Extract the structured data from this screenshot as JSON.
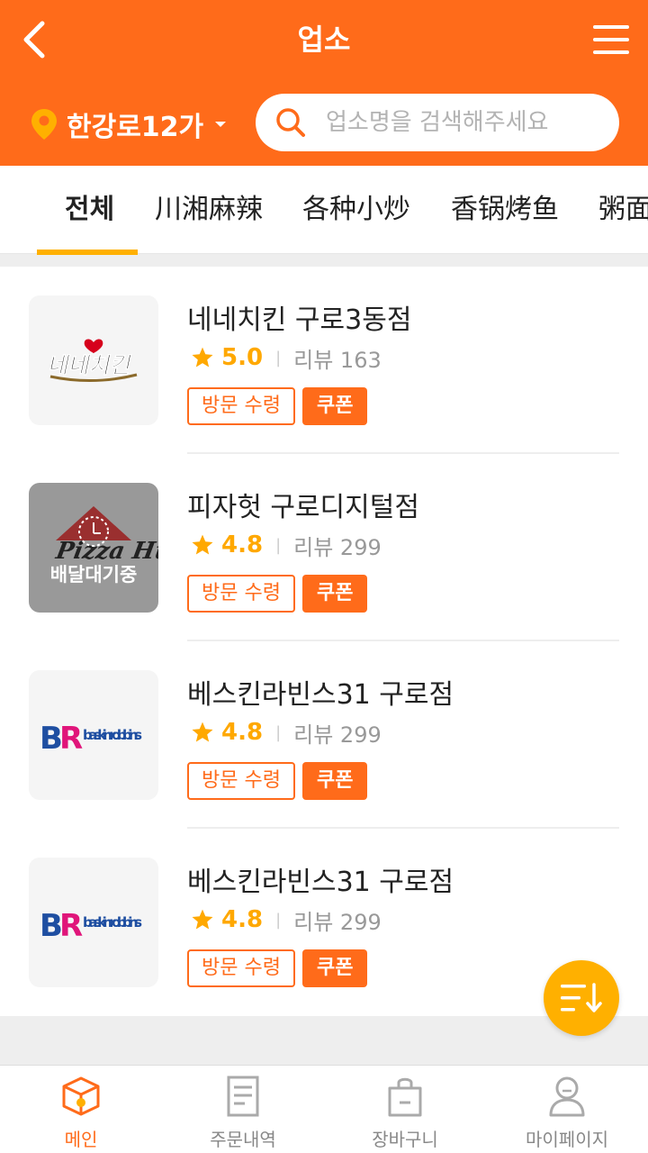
{
  "header": {
    "title": "업소",
    "location": "한강로12가",
    "search_placeholder": "업소명을 검색해주세요"
  },
  "tabs": [
    {
      "label": "전체",
      "active": true
    },
    {
      "label": "川湘麻辣",
      "active": false
    },
    {
      "label": "各种小炒",
      "active": false
    },
    {
      "label": "香锅烤鱼",
      "active": false
    },
    {
      "label": "粥面",
      "active": false
    }
  ],
  "stores": [
    {
      "name": "네네치킨 구로3동점",
      "score": "5.0",
      "reviews": "리뷰 163",
      "tag_visit": "방문 수령",
      "tag_coupon": "쿠폰",
      "logo": "nene-chicken-logo",
      "logo_text": "네네치킨",
      "overlay": null
    },
    {
      "name": "피자헛 구로디지털점",
      "score": "4.8",
      "reviews": "리뷰 299",
      "tag_visit": "방문 수령",
      "tag_coupon": "쿠폰",
      "logo": "pizza-hut-logo",
      "logo_text": "Pizza Hut",
      "overlay": "배달대기중"
    },
    {
      "name": "베스킨라빈스31 구로점",
      "score": "4.8",
      "reviews": "리뷰 299",
      "tag_visit": "방문 수령",
      "tag_coupon": "쿠폰",
      "logo": "baskin-robbins-logo",
      "logo_text": "baskin robbins",
      "overlay": null
    },
    {
      "name": "베스킨라빈스31 구로점",
      "score": "4.8",
      "reviews": "리뷰 299",
      "tag_visit": "방문 수령",
      "tag_coupon": "쿠폰",
      "logo": "baskin-robbins-logo",
      "logo_text": "baskin robbins",
      "overlay": null
    }
  ],
  "bottom_nav": [
    {
      "label": "메인",
      "icon": "box-icon",
      "active": true
    },
    {
      "label": "주문내역",
      "icon": "receipt-icon",
      "active": false
    },
    {
      "label": "장바구니",
      "icon": "bag-icon",
      "active": false
    },
    {
      "label": "마이페이지",
      "icon": "user-icon",
      "active": false
    }
  ],
  "colors": {
    "brand": "#ff6b1a",
    "accent": "#ffb000",
    "star": "#ffa800"
  }
}
